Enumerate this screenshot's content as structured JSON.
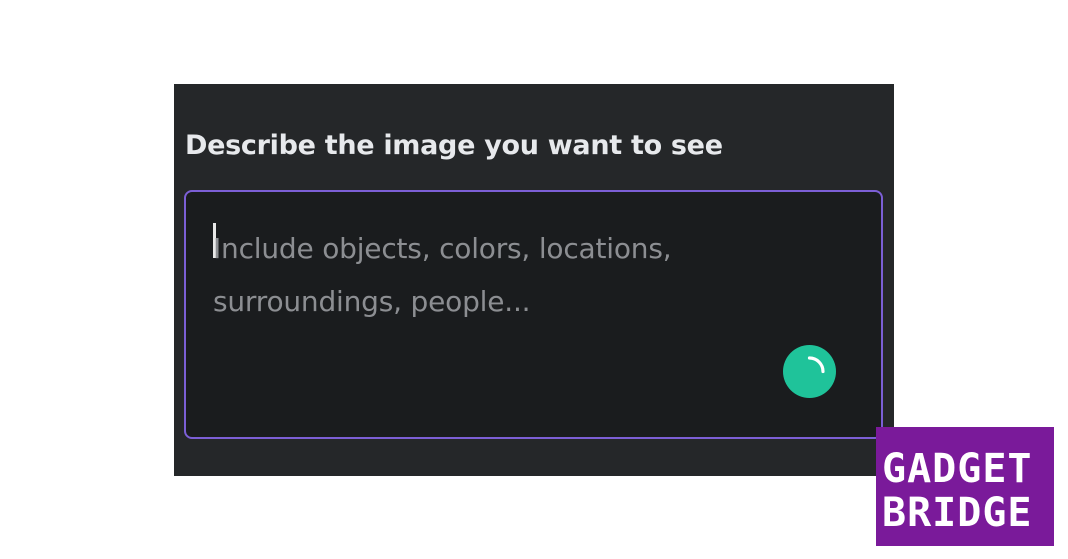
{
  "panel": {
    "label": "Describe the image you want to see",
    "prompt_placeholder": "Include objects, colors, locations,\nsurroundings, people...",
    "generate_icon": "loading-spinner-icon"
  },
  "watermark": {
    "line1": "GADGET",
    "line2": "BRIDGE"
  },
  "colors": {
    "panel_bg": "#252729",
    "input_bg": "#1a1c1e",
    "focus_border": "#7c5fd6",
    "accent": "#1fc39a",
    "watermark_bg": "#7a1a9a"
  }
}
